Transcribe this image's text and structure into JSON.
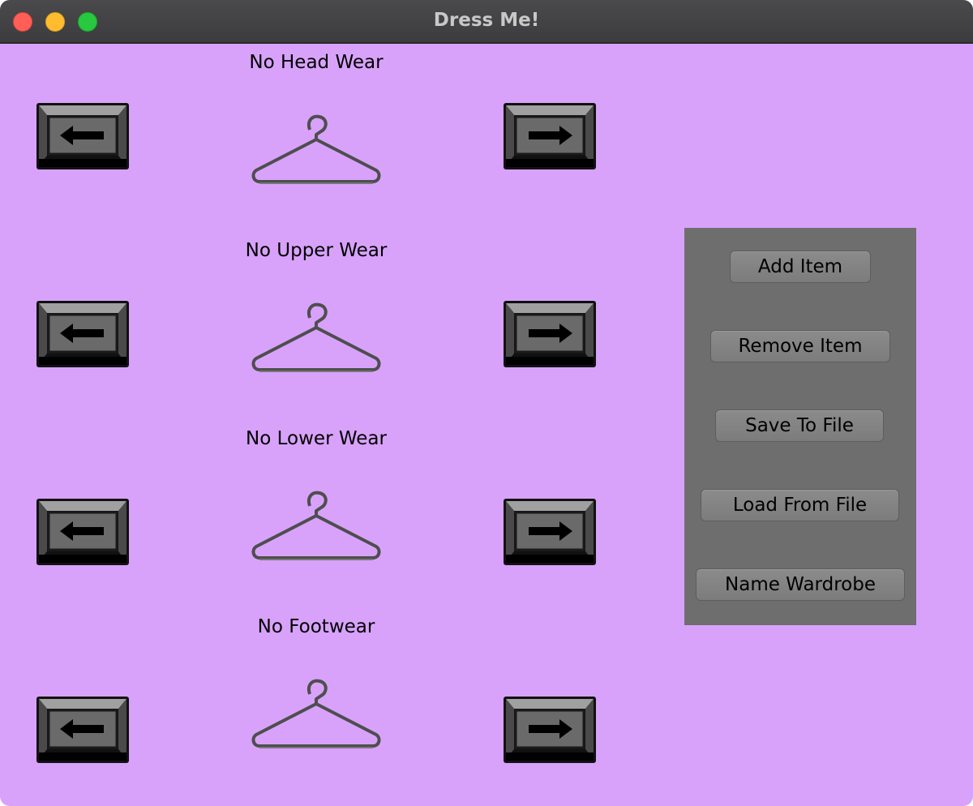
{
  "window": {
    "title": "Dress Me!",
    "background_color": "#d8a2fb"
  },
  "slots": [
    {
      "label": "No Head Wear",
      "item_icon": "hanger-icon",
      "prev_icon": "left-arrow-icon",
      "next_icon": "right-arrow-icon"
    },
    {
      "label": "No Upper Wear",
      "item_icon": "hanger-icon",
      "prev_icon": "left-arrow-icon",
      "next_icon": "right-arrow-icon"
    },
    {
      "label": "No Lower Wear",
      "item_icon": "hanger-icon",
      "prev_icon": "left-arrow-icon",
      "next_icon": "right-arrow-icon"
    },
    {
      "label": "No Footwear",
      "item_icon": "hanger-icon",
      "prev_icon": "left-arrow-icon",
      "next_icon": "right-arrow-icon"
    }
  ],
  "panel": {
    "background_color": "#6e6e6e",
    "buttons": [
      {
        "label": "Add Item"
      },
      {
        "label": "Remove Item"
      },
      {
        "label": "Save To File"
      },
      {
        "label": "Load From File"
      },
      {
        "label": "Name Wardrobe"
      }
    ]
  }
}
